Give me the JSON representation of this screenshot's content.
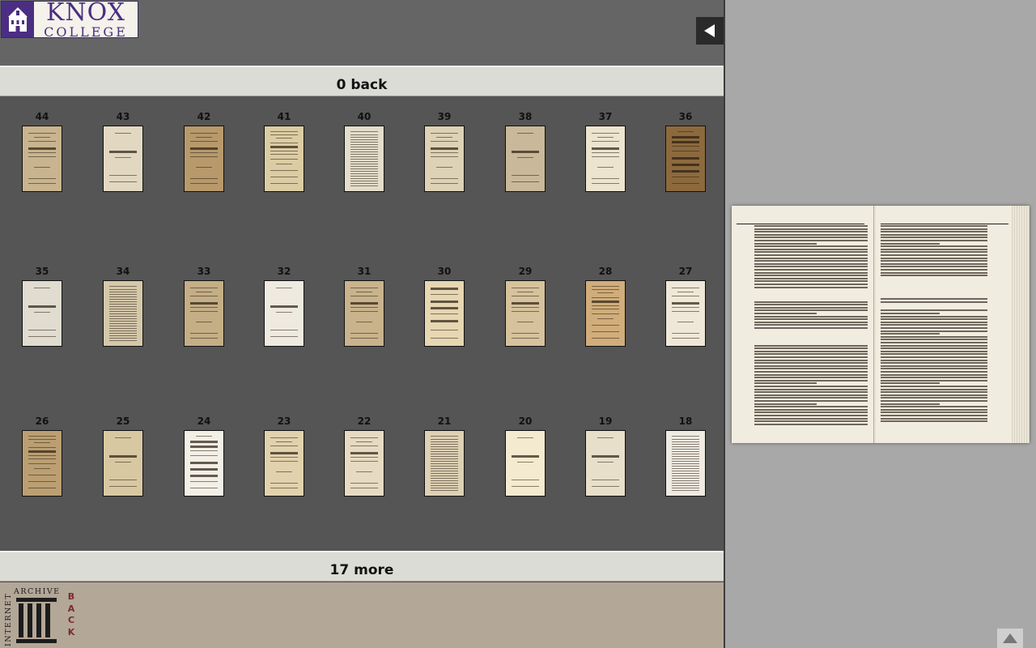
{
  "logo": {
    "line1": "KNOX",
    "line2": "COLLEGE"
  },
  "nav": {
    "back_label": "0 back",
    "more_label": "17 more"
  },
  "bottom": {
    "ia_text": "INTERNET ARCHIVE",
    "ia_letters": [
      "B",
      "A",
      "C",
      "K"
    ]
  },
  "colors": {
    "logo_purple": "#4b2e83",
    "panel_gray": "#555555",
    "bar_tan": "#b3a797"
  },
  "icons": {
    "collapse": "left-triangle-icon",
    "scroll": "up-triangle-icon"
  },
  "rows": [
    [
      {
        "num": "44",
        "bg": "#c8b48e",
        "style": "title"
      },
      {
        "num": "43",
        "bg": "#e2d8c2",
        "style": "plain"
      },
      {
        "num": "42",
        "bg": "#b7996c",
        "style": "title"
      },
      {
        "num": "41",
        "bg": "#dccca4",
        "style": "text"
      },
      {
        "num": "40",
        "bg": "#e4ddca",
        "style": "dense"
      },
      {
        "num": "39",
        "bg": "#ddd2b6",
        "style": "title"
      },
      {
        "num": "38",
        "bg": "#c9b99a",
        "style": "plain"
      },
      {
        "num": "37",
        "bg": "#ece4cf",
        "style": "title"
      },
      {
        "num": "36",
        "bg": "#8c6a3e",
        "style": "almanac"
      }
    ],
    [
      {
        "num": "35",
        "bg": "#e0dccf",
        "style": "plain"
      },
      {
        "num": "34",
        "bg": "#d4c8aa",
        "style": "dense"
      },
      {
        "num": "33",
        "bg": "#c3ae86",
        "style": "title"
      },
      {
        "num": "32",
        "bg": "#eeeae0",
        "style": "plain"
      },
      {
        "num": "31",
        "bg": "#c8b38c",
        "style": "title"
      },
      {
        "num": "30",
        "bg": "#e6d6b2",
        "style": "bold"
      },
      {
        "num": "29",
        "bg": "#d6c29c",
        "style": "title"
      },
      {
        "num": "28",
        "bg": "#d0ad7a",
        "style": "text"
      },
      {
        "num": "27",
        "bg": "#efe8d8",
        "style": "title"
      }
    ],
    [
      {
        "num": "26",
        "bg": "#bb9f72",
        "style": "text"
      },
      {
        "num": "25",
        "bg": "#d8c8a2",
        "style": "plain"
      },
      {
        "num": "24",
        "bg": "#f2efe6",
        "style": "almanac"
      },
      {
        "num": "23",
        "bg": "#e2d1ad",
        "style": "title"
      },
      {
        "num": "22",
        "bg": "#e6dbc2",
        "style": "title"
      },
      {
        "num": "21",
        "bg": "#ddd1b5",
        "style": "dense"
      },
      {
        "num": "20",
        "bg": "#f4ead0",
        "style": "plain"
      },
      {
        "num": "19",
        "bg": "#e8dfca",
        "style": "plain"
      },
      {
        "num": "18",
        "bg": "#efebe2",
        "style": "dense"
      }
    ]
  ]
}
